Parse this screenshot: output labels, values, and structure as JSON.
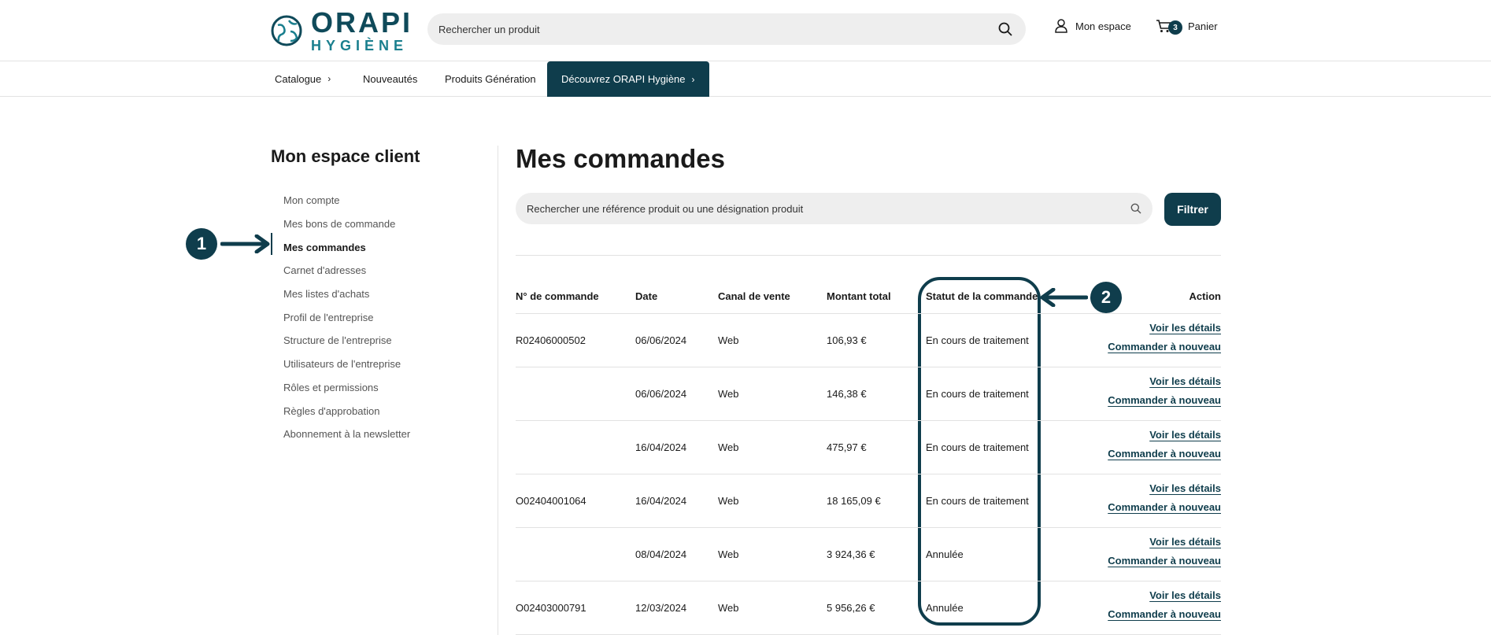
{
  "header": {
    "logo_main": "ORAPI",
    "logo_sub": "HYGIÈNE",
    "search_placeholder": "Rechercher un produit",
    "account_label": "Mon espace",
    "cart_count": "3",
    "cart_label": "Panier"
  },
  "nav": {
    "items": [
      {
        "label": "Catalogue",
        "chevron": "›"
      },
      {
        "label": "Nouveautés"
      },
      {
        "label": "Produits Génération"
      },
      {
        "label": "Découvrez ORAPI Hygiène",
        "chevron": "›"
      }
    ]
  },
  "sidebar": {
    "title": "Mon espace client",
    "items": [
      {
        "label": "Mon compte"
      },
      {
        "label": "Mes bons de commande"
      },
      {
        "label": "Mes commandes"
      },
      {
        "label": "Carnet d'adresses"
      },
      {
        "label": "Mes listes d'achats"
      },
      {
        "label": "Profil de l'entreprise"
      },
      {
        "label": "Structure de l'entreprise"
      },
      {
        "label": "Utilisateurs de l'entreprise"
      },
      {
        "label": "Rôles et permissions"
      },
      {
        "label": "Règles d'approbation"
      },
      {
        "label": "Abonnement à la newsletter"
      }
    ]
  },
  "annotations": {
    "callout1": "1",
    "callout2": "2"
  },
  "main": {
    "title": "Mes commandes",
    "search_placeholder": "Rechercher une référence produit ou une désignation produit",
    "filter_label": "Filtrer",
    "columns": [
      "N° de commande",
      "Date",
      "Canal de vente",
      "Montant total",
      "Statut de la commande",
      "Action"
    ],
    "action_details": "Voir les détails",
    "action_reorder": "Commander à nouveau",
    "rows": [
      {
        "order": "R02406000502",
        "date": "06/06/2024",
        "channel": "Web",
        "amount": "106,93 €",
        "status": "En cours de traitement"
      },
      {
        "order": "",
        "date": "06/06/2024",
        "channel": "Web",
        "amount": "146,38 €",
        "status": "En cours de traitement"
      },
      {
        "order": "",
        "date": "16/04/2024",
        "channel": "Web",
        "amount": "475,97 €",
        "status": "En cours de traitement"
      },
      {
        "order": "O02404001064",
        "date": "16/04/2024",
        "channel": "Web",
        "amount": "18 165,09 €",
        "status": "En cours de traitement"
      },
      {
        "order": "",
        "date": "08/04/2024",
        "channel": "Web",
        "amount": "3 924,36 €",
        "status": "Annulée"
      },
      {
        "order": "O02403000791",
        "date": "12/03/2024",
        "channel": "Web",
        "amount": "5 956,26 €",
        "status": "Annulée"
      }
    ]
  },
  "colors": {
    "brand_dark": "#0f3d4c",
    "brand_teal": "#1a7f8e",
    "search_bg": "#eeeeee"
  }
}
